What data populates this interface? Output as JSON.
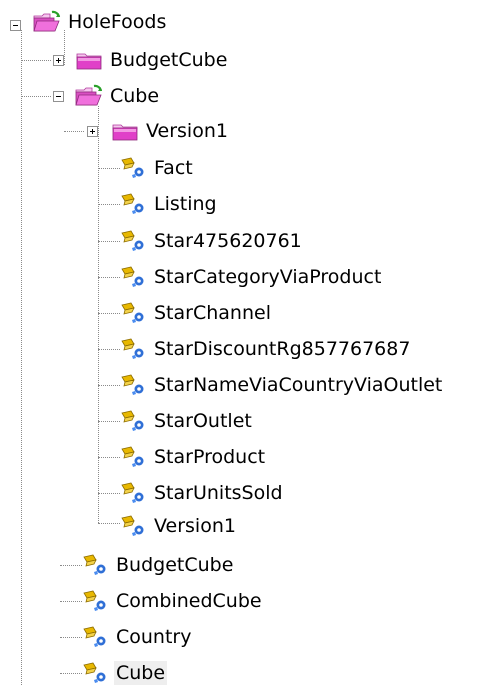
{
  "tree": {
    "root": {
      "label": "HoleFoods",
      "icon": "folder-open-icon",
      "children": [
        {
          "label": "BudgetCube",
          "icon": "folder-closed-icon",
          "expander": "plus"
        },
        {
          "label": "Cube",
          "icon": "folder-open-icon",
          "expander": "minus",
          "children": [
            {
              "label": "Version1",
              "icon": "folder-closed-icon",
              "expander": "plus"
            },
            {
              "label": "Fact",
              "icon": "cube-class-icon"
            },
            {
              "label": "Listing",
              "icon": "cube-class-icon"
            },
            {
              "label": "Star475620761",
              "icon": "cube-class-icon"
            },
            {
              "label": "StarCategoryViaProduct",
              "icon": "cube-class-icon"
            },
            {
              "label": "StarChannel",
              "icon": "cube-class-icon"
            },
            {
              "label": "StarDiscountRg857767687",
              "icon": "cube-class-icon"
            },
            {
              "label": "StarNameViaCountryViaOutlet",
              "icon": "cube-class-icon"
            },
            {
              "label": "StarOutlet",
              "icon": "cube-class-icon"
            },
            {
              "label": "StarProduct",
              "icon": "cube-class-icon"
            },
            {
              "label": "StarUnitsSold",
              "icon": "cube-class-icon"
            },
            {
              "label": "Version1",
              "icon": "cube-class-icon"
            }
          ]
        },
        {
          "label": "BudgetCube",
          "icon": "cube-class-icon"
        },
        {
          "label": "CombinedCube",
          "icon": "cube-class-icon"
        },
        {
          "label": "Country",
          "icon": "cube-class-icon"
        },
        {
          "label": "Cube",
          "icon": "cube-class-icon",
          "selected": true
        }
      ]
    }
  },
  "colors": {
    "folder_pink": "#e040c8",
    "folder_tab": "#f7c6ef",
    "folder_open_front": "#ef5ed8",
    "arrow_green": "#2aa02a",
    "key_gold": "#d9a400",
    "gear_blue": "#2f6fd6",
    "selection_bg": "#eeeeee"
  }
}
